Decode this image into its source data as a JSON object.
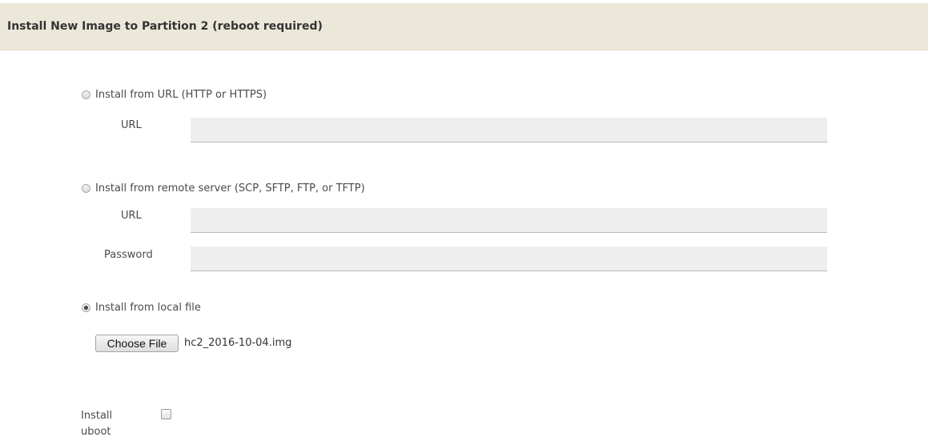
{
  "header": {
    "title": "Install New Image to Partition 2 (reboot required)"
  },
  "options": {
    "url": {
      "label": "Install from URL (HTTP or HTTPS)",
      "selected": false,
      "url_label": "URL",
      "url_value": ""
    },
    "remote": {
      "label": "Install from remote server (SCP, SFTP, FTP, or TFTP)",
      "selected": false,
      "url_label": "URL",
      "url_value": "",
      "password_label": "Password",
      "password_value": ""
    },
    "local": {
      "label": "Install from local file",
      "selected": true,
      "choose_button": "Choose File",
      "file_name": "hc2_2016-10-04.img"
    }
  },
  "uboot": {
    "label": "Install uboot",
    "checked": false
  }
}
